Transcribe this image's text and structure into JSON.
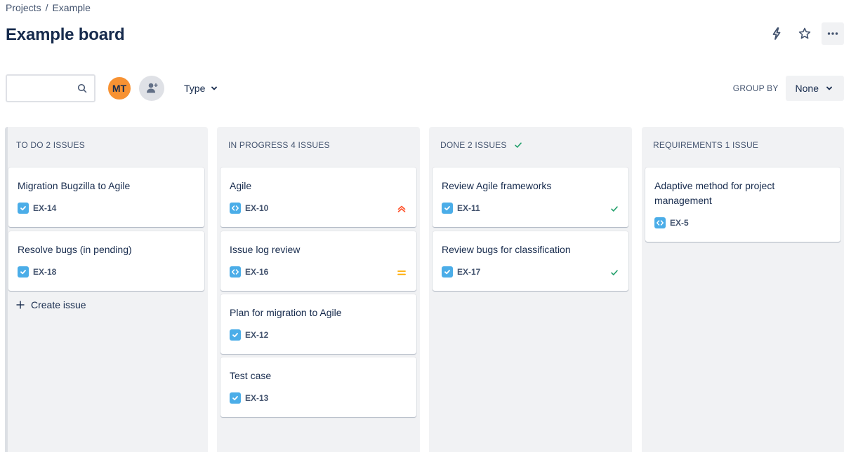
{
  "breadcrumb": {
    "projects": "Projects",
    "separator": "/",
    "current": "Example"
  },
  "page_title": "Example board",
  "toolbar": {
    "search_placeholder": "",
    "avatar_initials": "MT",
    "type_filter_label": "Type",
    "group_by_label": "GROUP BY",
    "group_by_value": "None"
  },
  "columns": [
    {
      "header": "TO DO 2 ISSUES",
      "cards": [
        {
          "title": "Migration Bugzilla to Agile",
          "key": "EX-14",
          "type": "task-icon"
        },
        {
          "title": "Resolve bugs (in pending)",
          "key": "EX-18",
          "type": "task-icon"
        }
      ],
      "create_label": "Create issue"
    },
    {
      "header": "IN PROGRESS 4 ISSUES",
      "cards": [
        {
          "title": "Agile",
          "key": "EX-10",
          "type": "story-icon",
          "priority": "highest-priority-icon"
        },
        {
          "title": "Issue log review",
          "key": "EX-16",
          "type": "story-icon",
          "priority": "medium-priority-icon"
        },
        {
          "title": "Plan for migration to Agile",
          "key": "EX-12",
          "type": "task-icon"
        },
        {
          "title": "Test case",
          "key": "EX-13",
          "type": "task-icon"
        }
      ]
    },
    {
      "header": "DONE 2 ISSUES",
      "cards": [
        {
          "title": "Review Agile frameworks",
          "key": "EX-11",
          "type": "task-icon",
          "status": "done-check-icon"
        },
        {
          "title": "Review bugs for classification",
          "key": "EX-17",
          "type": "task-icon",
          "status": "done-check-icon"
        }
      ]
    },
    {
      "header": "REQUIREMENTS 1 ISSUE",
      "cards": [
        {
          "title": "Adaptive method for project management",
          "key": "EX-5",
          "type": "story-icon"
        }
      ]
    }
  ],
  "colors": {
    "accent_blue": "#4bade8",
    "priority_high": "#ff5630",
    "priority_medium": "#ffab00",
    "done_green": "#22a06b",
    "avatar_orange": "#f79233"
  }
}
